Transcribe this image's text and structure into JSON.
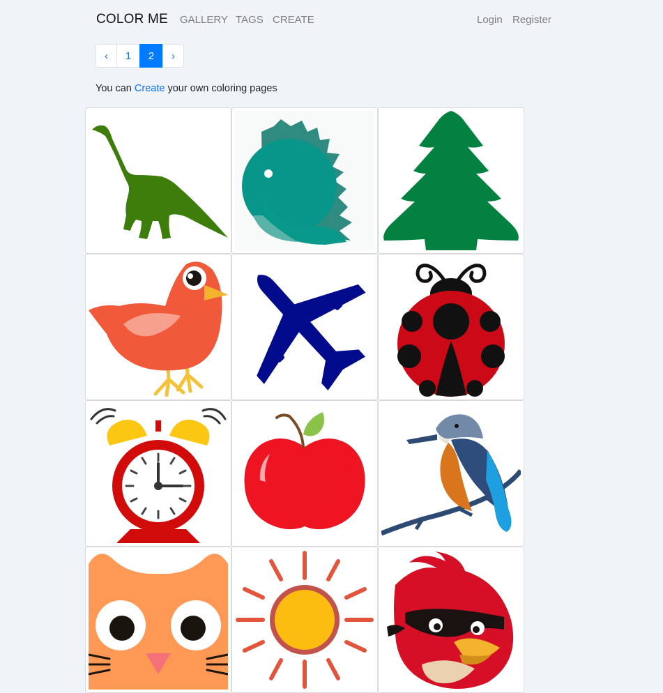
{
  "nav": {
    "brand": "COLOR ME",
    "links": [
      "GALLERY",
      "TAGS",
      "CREATE"
    ],
    "login": "Login",
    "register": "Register"
  },
  "pagination": {
    "prev": "‹",
    "pages": [
      "1",
      "2"
    ],
    "current_page": "2",
    "next": "›"
  },
  "intro": {
    "before": "You can",
    "link": "Create",
    "after": "your own coloring pages"
  },
  "gallery": {
    "items": [
      "dinosaur",
      "spiky-dinosaur",
      "pine-tree",
      "bird",
      "airplane",
      "ladybug",
      "alarm-clock",
      "apple",
      "kingfisher",
      "owl",
      "sun",
      "angry-bird"
    ]
  }
}
